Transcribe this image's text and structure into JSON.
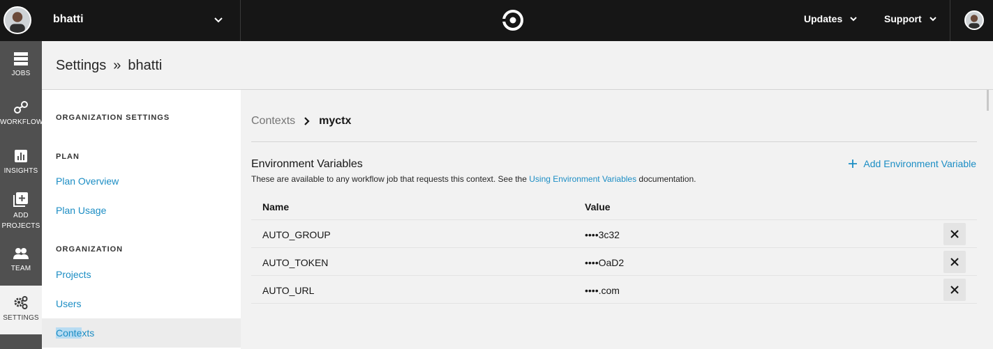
{
  "topbar": {
    "org_name": "bhatti",
    "menu": [
      {
        "label": "Updates"
      },
      {
        "label": "Support"
      }
    ]
  },
  "leftnav": [
    {
      "label": "JOBS",
      "icon": "jobs-icon"
    },
    {
      "label": "WORKFLOWS",
      "icon": "workflows-icon"
    },
    {
      "label": "INSIGHTS",
      "icon": "insights-icon"
    },
    {
      "label_line1": "ADD",
      "label_line2": "PROJECTS",
      "icon": "add-projects-icon"
    },
    {
      "label": "TEAM",
      "icon": "team-icon"
    },
    {
      "label": "SETTINGS",
      "icon": "settings-icon",
      "active": true
    }
  ],
  "header": {
    "section": "Settings",
    "separator": "»",
    "org": "bhatti"
  },
  "sidebar": {
    "heading_org_settings": "ORGANIZATION SETTINGS",
    "heading_plan": "PLAN",
    "plan_links": [
      "Plan Overview",
      "Plan Usage"
    ],
    "heading_org": "ORGANIZATION",
    "org_links": [
      "Projects",
      "Users"
    ],
    "active_link_selected": "Conte",
    "active_link_rest": "xts"
  },
  "main": {
    "breadcrumb_parent": "Contexts",
    "breadcrumb_current": "myctx",
    "section_title": "Environment Variables",
    "desc_before": "These are available to any workflow job that requests this context. See the ",
    "desc_link": "Using Environment Variables",
    "desc_after": " documentation.",
    "add_button": "Add Environment Variable",
    "table": {
      "headers": {
        "name": "Name",
        "value": "Value"
      },
      "rows": [
        {
          "name": "AUTO_GROUP",
          "value": "••••3c32"
        },
        {
          "name": "AUTO_TOKEN",
          "value": "••••OaD2"
        },
        {
          "name": "AUTO_URL",
          "value": "••••.com"
        }
      ]
    }
  },
  "colors": {
    "topbar": "#161616",
    "leftnav": "#505050",
    "link": "#1b8dc4",
    "background": "#f2f2f2"
  }
}
